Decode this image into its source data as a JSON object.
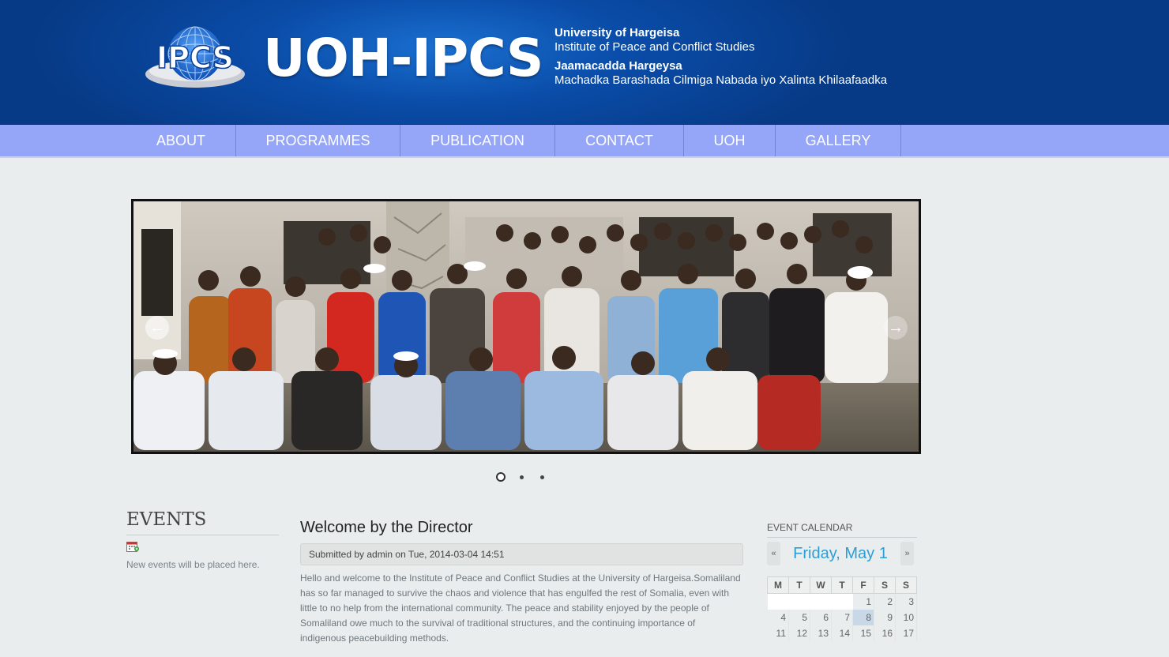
{
  "header": {
    "brand": "UOH-IPCS",
    "logo_text": "IPCS",
    "institution_en_name": "University of Hargeisa",
    "institution_en_sub": "Institute of Peace and Conflict Studies",
    "institution_so_name": "Jaamacadda Hargeysa",
    "institution_so_sub": "Machadka Barashada Cilmiga Nabada iyo Xalinta Khilaafaadka"
  },
  "nav": {
    "items": [
      {
        "label": "ABOUT"
      },
      {
        "label": "PROGRAMMES"
      },
      {
        "label": "PUBLICATION"
      },
      {
        "label": "CONTACT"
      },
      {
        "label": "UOH"
      },
      {
        "label": "GALLERY"
      }
    ]
  },
  "slider": {
    "slide_count": 3,
    "active_index": 0
  },
  "events": {
    "title": "EVENTS",
    "empty_text": "New events will be placed here."
  },
  "welcome": {
    "title": "Welcome by the Director",
    "submitted": "Submitted by admin on Tue, 2014-03-04 14:51",
    "body": "Hello and welcome to the Institute of Peace and Conflict Studies at the University of Hargeisa.Somaliland has so far managed to survive the chaos and violence that has engulfed the rest of Somalia, even with little to no help from the international community. The peace and stability enjoyed by the people of Somaliland owe much to the survival of traditional structures, and the continuing importance of indigenous peacebuilding methods."
  },
  "calendar": {
    "title": "EVENT CALENDAR",
    "prev": "«",
    "next": "»",
    "current_date": "Friday, May 1",
    "weekdays": [
      "M",
      "T",
      "W",
      "T",
      "F",
      "S",
      "S"
    ],
    "weeks": [
      [
        "",
        "",
        "",
        "",
        "1",
        "2",
        "3"
      ],
      [
        "4",
        "5",
        "6",
        "7",
        "8",
        "9",
        "10"
      ],
      [
        "11",
        "12",
        "13",
        "14",
        "15",
        "16",
        "17"
      ]
    ],
    "highlight": "8"
  },
  "colors": {
    "header_blue": "#0a4ca8",
    "nav_bg": "#95a5f8",
    "page_bg": "#e9edee",
    "calendar_accent": "#2a9fd6"
  }
}
